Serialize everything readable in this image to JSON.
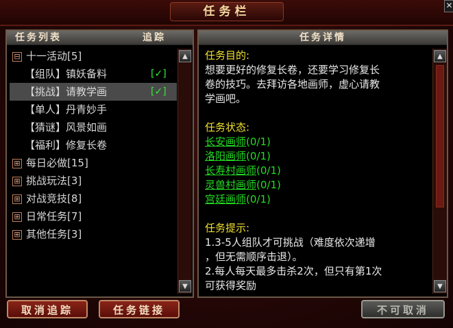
{
  "window": {
    "title": "任务栏",
    "close_icon": "close-icon"
  },
  "left_panel": {
    "header_list": "任务列表",
    "header_track": "追踪",
    "categories": [
      {
        "toggle": "⊟",
        "label": "十一活动[5]",
        "expanded": true,
        "items": [
          {
            "label": "【组队】镇妖备料",
            "track": "[✓]",
            "selected": false
          },
          {
            "label": "【挑战】请教学画",
            "track": "[✓]",
            "selected": true
          },
          {
            "label": "【单人】丹青妙手",
            "track": "",
            "selected": false
          },
          {
            "label": "【猜谜】风景如画",
            "track": "",
            "selected": false
          },
          {
            "label": "【福利】修复长卷",
            "track": "",
            "selected": false
          }
        ]
      },
      {
        "toggle": "⊞",
        "label": "每日必做[15]",
        "expanded": false
      },
      {
        "toggle": "⊞",
        "label": "挑战玩法[3]",
        "expanded": false
      },
      {
        "toggle": "⊞",
        "label": "对战竞技[8]",
        "expanded": false
      },
      {
        "toggle": "⊞",
        "label": "日常任务[7]",
        "expanded": false
      },
      {
        "toggle": "⊞",
        "label": "其他任务[3]",
        "expanded": false
      }
    ]
  },
  "right_panel": {
    "header": "任务详情",
    "goal_title": "任务目的:",
    "goal_lines": [
      "想要更好的修复长卷，还要学习修复长",
      "卷的技巧。去拜访各地画师，虚心请教",
      "学画吧。"
    ],
    "status_title": "任务状态:",
    "status_items": [
      {
        "name": "长安画师",
        "progress": "(0/1)"
      },
      {
        "name": "洛阳画师",
        "progress": "(0/1)"
      },
      {
        "name": "长寿村画师",
        "progress": "(0/1)"
      },
      {
        "name": "灵兽村画师",
        "progress": "(0/1)"
      },
      {
        "name": "宫廷画师",
        "progress": "(0/1)"
      }
    ],
    "hint_title": "任务提示:",
    "hint_lines": [
      "1.3-5人组队才可挑战（难度依次递增",
      "，但无需顺序击退）。",
      "2.每人每天最多击杀2次，但只有第1次",
      "可获得奖励"
    ]
  },
  "buttons": {
    "untrack": "取消追踪",
    "link": "任务链接",
    "cancel": "不可取消"
  },
  "colors": {
    "accent_yellow": "#f0e030",
    "link_green": "#22dd22",
    "frame_red": "#3a0e0b"
  }
}
